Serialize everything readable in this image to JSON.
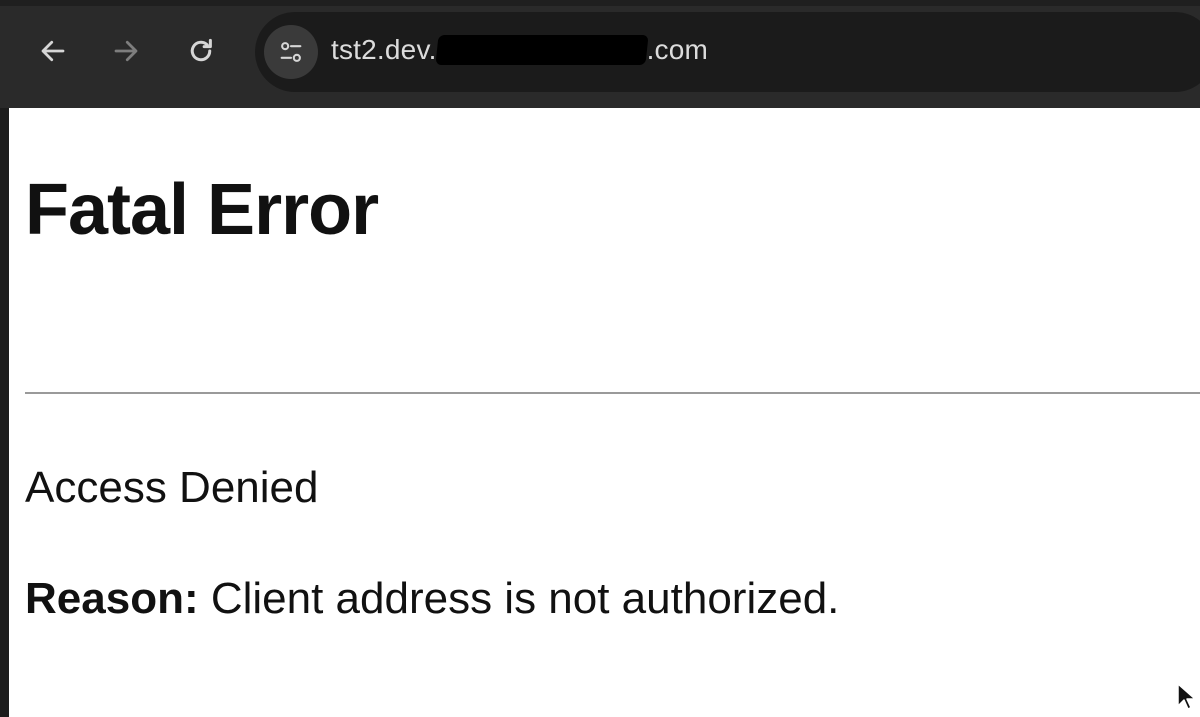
{
  "browser": {
    "url_prefix": "tst2.dev.",
    "url_suffix": ".com",
    "icons": {
      "back": "arrow-left-icon",
      "forward": "arrow-right-icon",
      "reload": "reload-icon",
      "site_info": "site-settings-icon"
    }
  },
  "page": {
    "title": "Fatal Error",
    "message": "Access Denied",
    "reason_label": "Reason:",
    "reason_text": " Client address is not authorized."
  }
}
